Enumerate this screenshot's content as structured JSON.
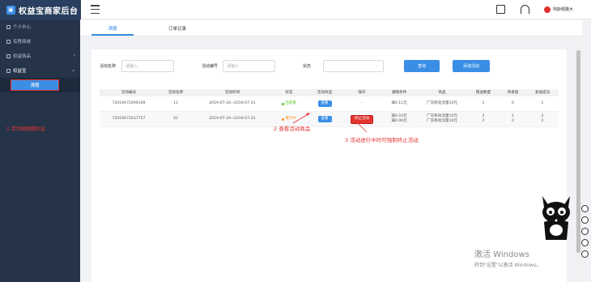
{
  "app": {
    "title": "权益宝商家后台",
    "username": "阿斯顿撒大"
  },
  "sidebar": {
    "items": [
      {
        "label": "个人中心"
      },
      {
        "label": "有赞商城"
      },
      {
        "label": "权益商品"
      },
      {
        "label": "权益宝"
      }
    ],
    "sub_item": "满赠",
    "annotation": "1 活动满额赠权益"
  },
  "tabs": [
    {
      "label": "满赠"
    },
    {
      "label": "订单记录"
    }
  ],
  "filters": {
    "name_label": "活动名称",
    "name_placeholder": "请输入",
    "id_label": "活动编号",
    "id_placeholder": "请输入",
    "status_label": "状态",
    "search_btn": "查询",
    "add_btn": "添加活动"
  },
  "table": {
    "headers": [
      "活动编号",
      "活动名称",
      "活动时间",
      "状态",
      "活动商品",
      "操作",
      "满赠条件",
      "商品",
      "赠送数量",
      "待发放",
      "发送成功"
    ],
    "rows": [
      {
        "id": "72019072496169",
        "name": "11",
        "time": "2019-07-24~2019-07-31",
        "status": "已结束",
        "status_color": "#52c41a",
        "goods_btn": "查看",
        "op": "-",
        "conditions": [
          "满0.11元"
        ],
        "products": [
          "广东移动流量10元"
        ],
        "qty": [
          "1"
        ],
        "pending": [
          "0"
        ],
        "success": [
          "1"
        ]
      },
      {
        "id": "72019072437757",
        "name": "22",
        "time": "2019-07-24~2019-07-31",
        "status": "进行中",
        "status_color": "#fa8c16",
        "goods_btn": "查看",
        "op": "终止活动",
        "conditions": [
          "满0.03元",
          "满0.06元"
        ],
        "products": [
          "广东移动流量10元",
          "广东移动流量10元"
        ],
        "qty": [
          "3",
          "2"
        ],
        "pending": [
          "1",
          "0"
        ],
        "success": [
          "2",
          "2"
        ]
      }
    ]
  },
  "annotations": {
    "a2": "2 查看活动商品",
    "a3": "3 活动进行中时可强制终止活动"
  },
  "watermark": {
    "line1": "激活 Windows",
    "line2": "转到\"设置\"以激活 Windows。"
  }
}
